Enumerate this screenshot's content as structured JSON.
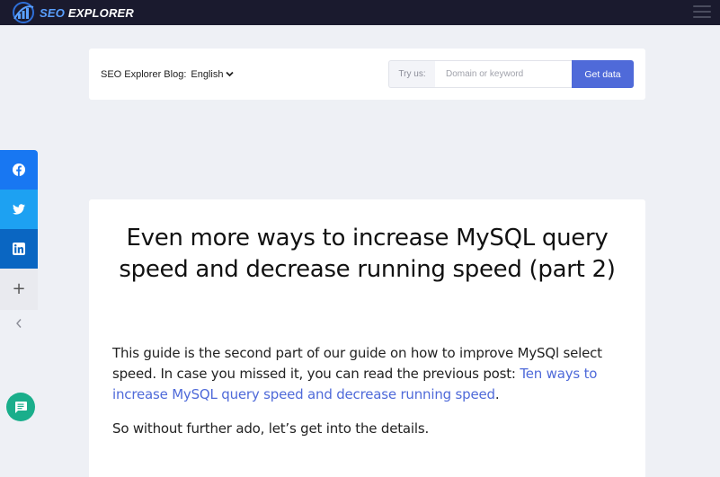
{
  "header": {
    "logo_text_seo": "SEO",
    "logo_text_rest": " EXPLORER",
    "logo_icon": "seo-explorer-logo",
    "menu_icon": "hamburger-icon"
  },
  "search_bar": {
    "blog_label": "SEO Explorer Blog:",
    "language": "English",
    "try_label": "Try us:",
    "input_placeholder": "Domain or keyword",
    "input_value": "",
    "button_label": "Get data"
  },
  "share_bar": {
    "items": [
      {
        "icon": "facebook-icon"
      },
      {
        "icon": "twitter-icon"
      },
      {
        "icon": "linkedin-icon"
      },
      {
        "icon": "plus-icon",
        "glyph": "+"
      },
      {
        "icon": "chevron-left-icon"
      }
    ]
  },
  "chat": {
    "icon": "chat-icon"
  },
  "article": {
    "title": "Even more ways to increase MySQL query speed and decrease running speed (part 2)",
    "intro_text": "This guide is the second part of our guide on how to improve MySQl select speed. In case you missed it, you can read the previous post: ",
    "intro_link": "Ten ways to increase MySQL query speed and decrease running speed",
    "intro_end": ".",
    "paragraph_2": "So without further ado, let’s get into the details."
  },
  "colors": {
    "topbar": "#1a1a2e",
    "accent": "#4f6ad9",
    "facebook": "#1877f2",
    "twitter": "#1da1f2",
    "linkedin": "#0a66c2",
    "chat": "#1aae8b",
    "page_background": "#eef0f5"
  }
}
